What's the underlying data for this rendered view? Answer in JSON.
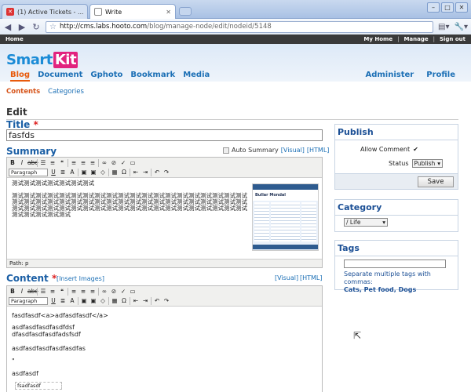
{
  "browser": {
    "tabs": [
      {
        "title": "(1) Active Tickets - ..."
      },
      {
        "title": "Write"
      }
    ],
    "url_host": "http://cms.labs.hooto.com",
    "url_path": "/blog/manage-node/edit/nodeid/5148"
  },
  "sitebar": {
    "home": "Home",
    "my_home": "My Home",
    "manage": "Manage",
    "sign_out": "Sign out",
    "sep": "|"
  },
  "brand": {
    "smart": "Smart",
    "kit": "Kit"
  },
  "nav": {
    "left": [
      "Blog",
      "Document",
      "Gphoto",
      "Bookmark",
      "Media"
    ],
    "right": [
      "Administer",
      "Profile"
    ]
  },
  "subnav": {
    "contents": "Contents",
    "categories": "Categories"
  },
  "page": {
    "heading": "Edit"
  },
  "form": {
    "title_label": "Title",
    "required_mark": "*",
    "title_value": "fasfds",
    "summary_label": "Summary",
    "auto_summary": "Auto Summary",
    "visual": "[Visual]",
    "html": "[HTML]",
    "summary_line1": "测试测试测试测试测试测试测试",
    "summary_body": "测试测试测试测试测试测试测试测试测试测试测试测试测试测试测试测试测试测试测试测试测试测试测试测试测试测试测试测试测试测试测试测试测试测试测试测试测试测试测试测试测试测试测试测试测试测试测试测试测试测试测试测试测试测试测试测试测试测试测试测试测试测试测试测试测试",
    "path": "Path: p",
    "content_label": "Content",
    "insert_images": "[Insert Images]",
    "content_lines": [
      "fasdfasdf<a>adfasdfasdf</a>",
      "asdfasdfasdfasdfdsf",
      "dfasdfasdfasdfadsfsdf",
      "asdfasdfasdfasdfasdfas",
      "\"",
      "asdfasdf"
    ],
    "content_placeholder": "fsadfasdf",
    "format_select": "Paragraph",
    "thumb_title": "Bullar Mondal"
  },
  "publish": {
    "heading": "Publish",
    "allow_comment": "Allow Comment",
    "allow_comment_checked": true,
    "status_label": "Status",
    "status_value": "Publish",
    "save": "Save"
  },
  "category": {
    "heading": "Category",
    "selected": "/ Life"
  },
  "tags": {
    "heading": "Tags",
    "help": "Separate multiple tags with commas:",
    "examples": "Cats, Pet food, Dogs"
  },
  "colors": {
    "brand_blue": "#1b8bd6",
    "brand_pink": "#e2237e",
    "nav_active": "#e85a0c",
    "link": "#1b6fb5"
  }
}
